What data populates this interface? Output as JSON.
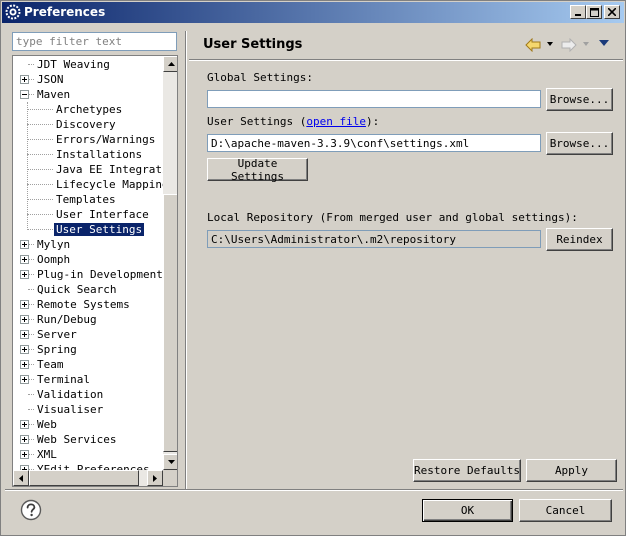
{
  "window": {
    "title": "Preferences"
  },
  "filter": {
    "placeholder": "type filter text"
  },
  "tree": {
    "items": [
      {
        "label": "JDT Weaving",
        "level": 0,
        "expander": "none"
      },
      {
        "label": "JSON",
        "level": 0,
        "expander": "plus"
      },
      {
        "label": "Maven",
        "level": 0,
        "expander": "minus"
      },
      {
        "label": "Archetypes",
        "level": 1,
        "expander": "none"
      },
      {
        "label": "Discovery",
        "level": 1,
        "expander": "none"
      },
      {
        "label": "Errors/Warnings",
        "level": 1,
        "expander": "none"
      },
      {
        "label": "Installations",
        "level": 1,
        "expander": "none"
      },
      {
        "label": "Java EE Integratio",
        "level": 1,
        "expander": "none"
      },
      {
        "label": "Lifecycle Mappings",
        "level": 1,
        "expander": "none"
      },
      {
        "label": "Templates",
        "level": 1,
        "expander": "none"
      },
      {
        "label": "User Interface",
        "level": 1,
        "expander": "none"
      },
      {
        "label": "User Settings",
        "level": 1,
        "expander": "none",
        "selected": true
      },
      {
        "label": "Mylyn",
        "level": 0,
        "expander": "plus"
      },
      {
        "label": "Oomph",
        "level": 0,
        "expander": "plus"
      },
      {
        "label": "Plug-in Development",
        "level": 0,
        "expander": "plus"
      },
      {
        "label": "Quick Search",
        "level": 0,
        "expander": "none"
      },
      {
        "label": "Remote Systems",
        "level": 0,
        "expander": "plus"
      },
      {
        "label": "Run/Debug",
        "level": 0,
        "expander": "plus"
      },
      {
        "label": "Server",
        "level": 0,
        "expander": "plus"
      },
      {
        "label": "Spring",
        "level": 0,
        "expander": "plus"
      },
      {
        "label": "Team",
        "level": 0,
        "expander": "plus"
      },
      {
        "label": "Terminal",
        "level": 0,
        "expander": "plus"
      },
      {
        "label": "Validation",
        "level": 0,
        "expander": "none"
      },
      {
        "label": "Visualiser",
        "level": 0,
        "expander": "none"
      },
      {
        "label": "Web",
        "level": 0,
        "expander": "plus"
      },
      {
        "label": "Web Services",
        "level": 0,
        "expander": "plus"
      },
      {
        "label": "XML",
        "level": 0,
        "expander": "plus"
      },
      {
        "label": "YEdit Preferences",
        "level": 0,
        "expander": "plus"
      }
    ]
  },
  "page": {
    "title": "User Settings",
    "global_settings_label": "Global Settings:",
    "global_settings_value": "",
    "browse_label": "Browse...",
    "user_settings_label_prefix": "User Settings (",
    "open_file_link": "open file",
    "user_settings_label_suffix": "):",
    "user_settings_value": "D:\\apache-maven-3.3.9\\conf\\settings.xml",
    "update_settings_label": "Update Settings",
    "local_repo_label": "Local Repository (From merged user and global settings):",
    "local_repo_value": "C:\\Users\\Administrator\\.m2\\repository",
    "reindex_label": "Reindex",
    "restore_defaults_label": "Restore Defaults",
    "apply_label": "Apply"
  },
  "footer": {
    "ok_label": "OK",
    "cancel_label": "Cancel"
  },
  "icons": {
    "app": "eclipse-gear-icon",
    "back": "back-arrow-icon",
    "forward": "forward-arrow-icon",
    "menu": "view-menu-icon",
    "help": "help-icon"
  },
  "colors": {
    "selection": "#0a246a",
    "title_gradient_start": "#0a246a",
    "title_gradient_end": "#a6caf0",
    "link": "#0000ee"
  }
}
